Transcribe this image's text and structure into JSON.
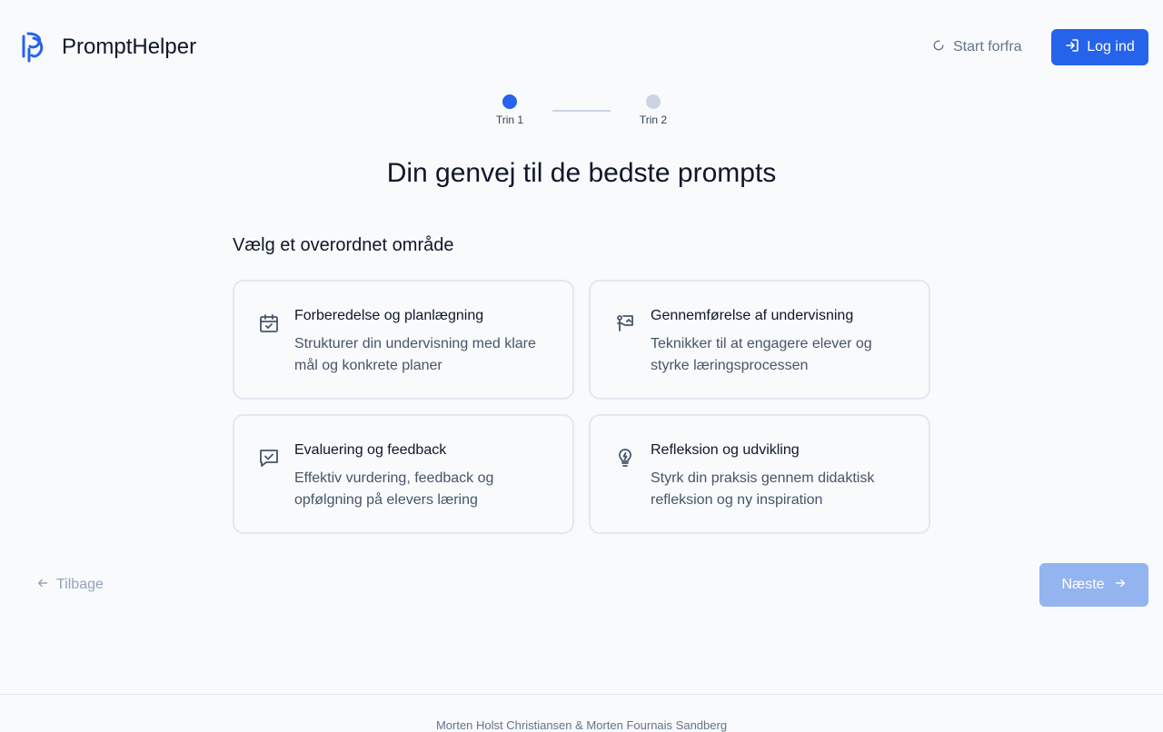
{
  "header": {
    "brand": "PromptHelper",
    "restart_label": "Start forfra",
    "login_label": "Log ind"
  },
  "stepper": {
    "steps": [
      {
        "label": "Trin 1",
        "active": true
      },
      {
        "label": "Trin 2",
        "active": false
      }
    ]
  },
  "main": {
    "title": "Din genvej til de bedste prompts",
    "subtitle": "Vælg et overordnet område",
    "cards": [
      {
        "title": "Forberedelse og planlægning",
        "description": "Strukturer din undervisning med klare mål og konkrete planer",
        "icon": "calendar-check-icon"
      },
      {
        "title": "Gennemførelse af undervisning",
        "description": "Teknikker til at engagere elever og styrke læringsprocessen",
        "icon": "presentation-icon"
      },
      {
        "title": "Evaluering og feedback",
        "description": "Effektiv vurdering, feedback og opfølgning på elevers læring",
        "icon": "message-check-icon"
      },
      {
        "title": "Refleksion og udvikling",
        "description": "Styrk din praksis gennem didaktisk refleksion og ny inspiration",
        "icon": "lightbulb-icon"
      }
    ]
  },
  "nav": {
    "back_label": "Tilbage",
    "next_label": "Næste"
  },
  "footer": {
    "credits": "Morten Holst Christiansen & Morten Fournais Sandberg"
  },
  "colors": {
    "accent": "#2563eb",
    "accent_disabled": "#93b4ee",
    "background": "#f8fafc",
    "border": "#e2e8f0"
  }
}
